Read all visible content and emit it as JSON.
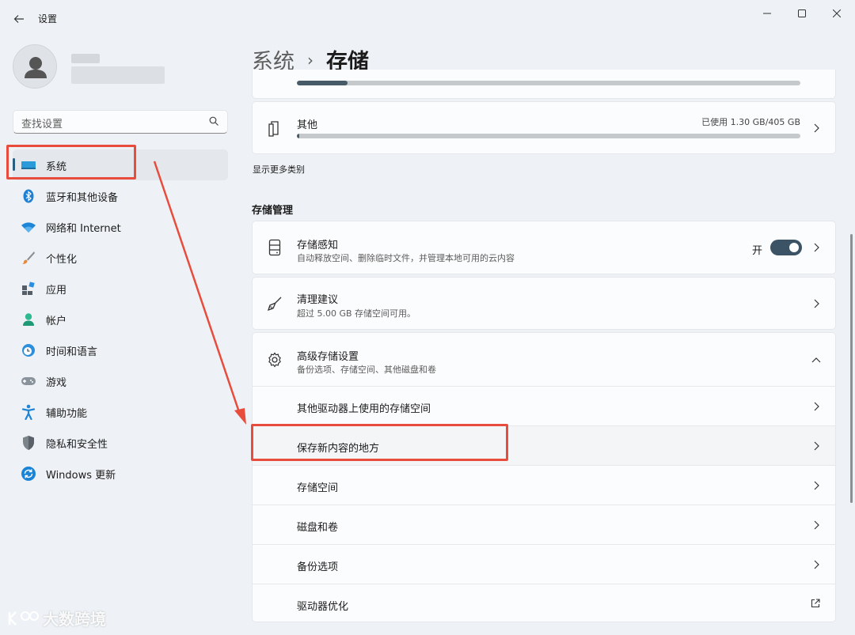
{
  "app": {
    "title": "设置"
  },
  "search": {
    "placeholder": "查找设置"
  },
  "sidebar": {
    "items": [
      {
        "label": "系统",
        "icon": "system-icon",
        "active": true
      },
      {
        "label": "蓝牙和其他设备",
        "icon": "bluetooth-icon"
      },
      {
        "label": "网络和 Internet",
        "icon": "wifi-icon"
      },
      {
        "label": "个性化",
        "icon": "brush-icon"
      },
      {
        "label": "应用",
        "icon": "apps-icon"
      },
      {
        "label": "帐户",
        "icon": "account-icon"
      },
      {
        "label": "时间和语言",
        "icon": "clock-globe-icon"
      },
      {
        "label": "游戏",
        "icon": "gamepad-icon"
      },
      {
        "label": "辅助功能",
        "icon": "accessibility-icon"
      },
      {
        "label": "隐私和安全性",
        "icon": "shield-icon"
      },
      {
        "label": "Windows 更新",
        "icon": "update-icon"
      }
    ]
  },
  "breadcrumb": {
    "parent": "系统",
    "separator": "›",
    "current": "存储"
  },
  "storage": {
    "top_progress": 0.1,
    "other": {
      "title": "其他",
      "usage": "已使用 1.30 GB/405 GB",
      "progress": 0.0032
    },
    "show_more": "显示更多类别"
  },
  "management": {
    "section_title": "存储管理",
    "sense": {
      "title": "存储感知",
      "subtitle": "自动释放空间、删除临时文件，并管理本地可用的云内容",
      "toggle_label": "开",
      "toggle_on": true
    },
    "cleanup": {
      "title": "清理建议",
      "subtitle": "超过 5.00 GB 存储空间可用。"
    },
    "advanced": {
      "title": "高级存储设置",
      "subtitle": "备份选项、存储空间、其他磁盘和卷",
      "items": [
        "其他驱动器上使用的存储空间",
        "保存新内容的地方",
        "存储空间",
        "磁盘和卷",
        "备份选项",
        "驱动器优化"
      ]
    }
  },
  "annotation_color": "#e84c3d",
  "accent": "#3b5364",
  "watermark": "大数跨境"
}
